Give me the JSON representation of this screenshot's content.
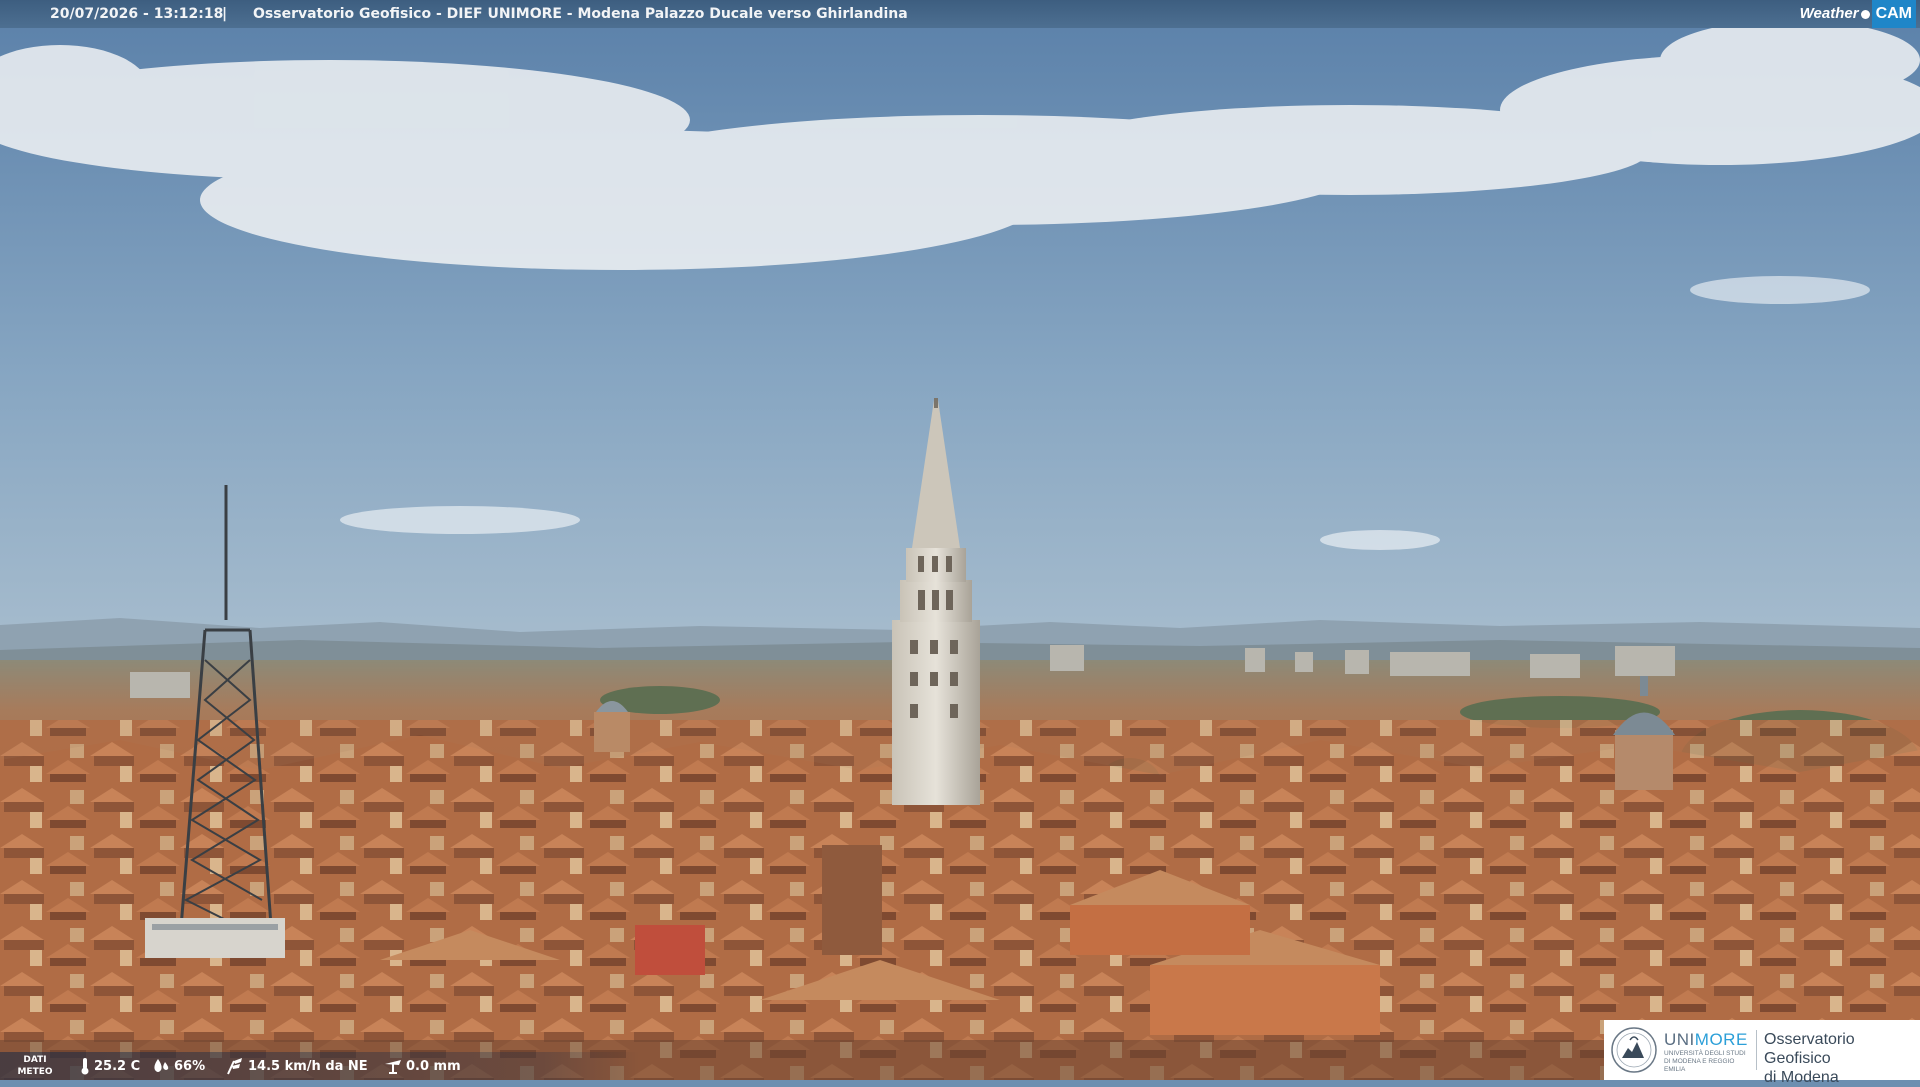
{
  "header": {
    "timestamp": "20/07/2026 - 13:12:18",
    "separator": "|",
    "title": "Osservatorio Geofisico - DIEF UNIMORE - Modena Palazzo Ducale verso Ghirlandina"
  },
  "brand_logo": {
    "weather": "Weather",
    "cam": "CAM",
    "accent": "#1f86c8"
  },
  "meteo": {
    "label_line1": "DATI",
    "label_line2": "METEO",
    "temperature": "25.2 C",
    "humidity": "66%",
    "wind": "14.5 km/h da NE",
    "rain": "0.0 mm",
    "icons": [
      "thermometer-icon",
      "humidity-drop-icon",
      "wind-icon",
      "rain-gauge-icon"
    ]
  },
  "unimore_logo": {
    "brand_part1": "UNI",
    "brand_part2": "MORE",
    "university_text": "UNIVERSITÀ DEGLI STUDI DI MODENA E REGGIO EMILIA",
    "observatory_line1": "Osservatorio Geofisico",
    "observatory_line2": "di Modena",
    "accent": "#2b9fd8"
  },
  "palette": {
    "sky_top": "#5c82aa",
    "sky_horizon": "#d6dde2",
    "mountains": "#8c9fb0",
    "roofs": "#b9714a",
    "tower_stone": "#d6d2c8"
  }
}
